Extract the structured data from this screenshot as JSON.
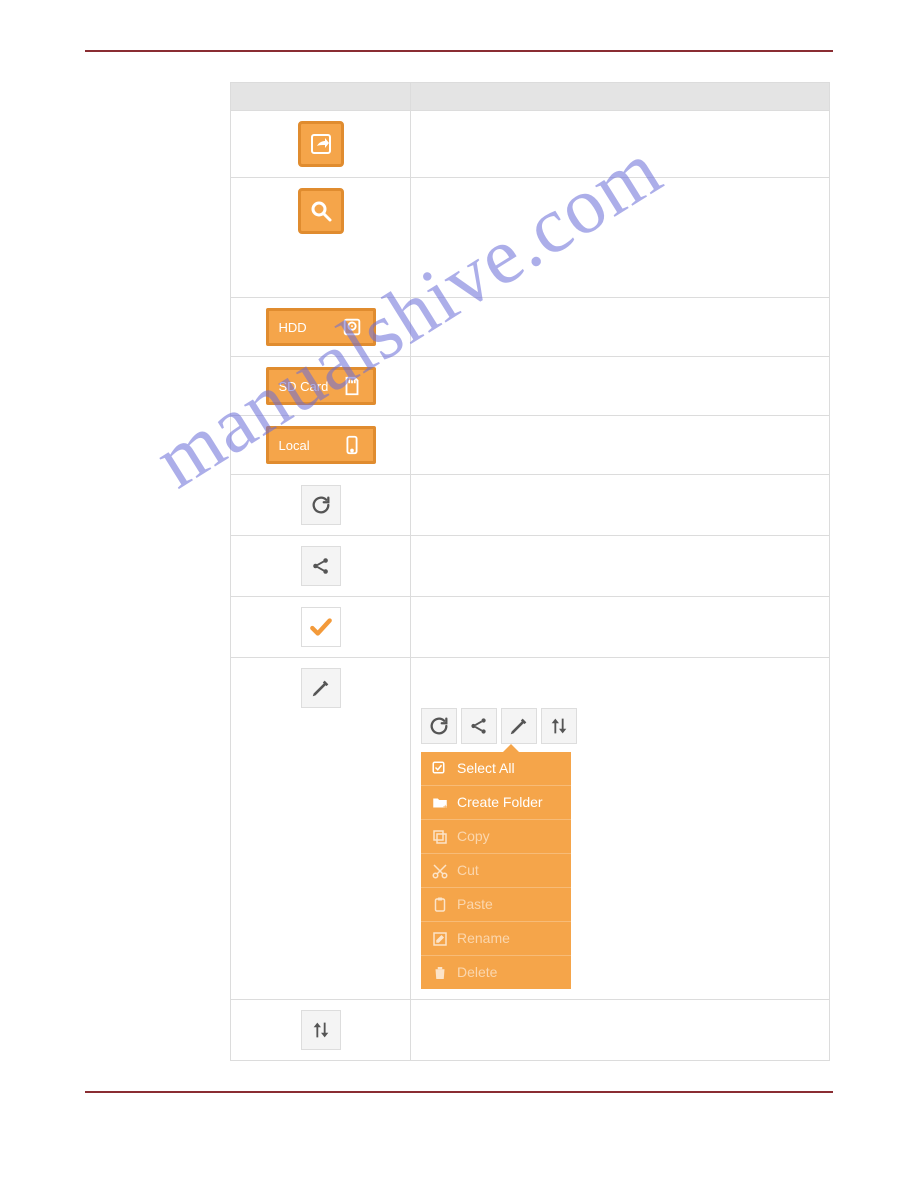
{
  "watermark": "manualshive.com",
  "storage": {
    "hdd": "HDD",
    "sd": "SD Card",
    "local": "Local"
  },
  "edit_menu": {
    "select_all": "Select All",
    "create_folder": "Create Folder",
    "copy": "Copy",
    "cut": "Cut",
    "paste": "Paste",
    "rename": "Rename",
    "delete": "Delete"
  }
}
